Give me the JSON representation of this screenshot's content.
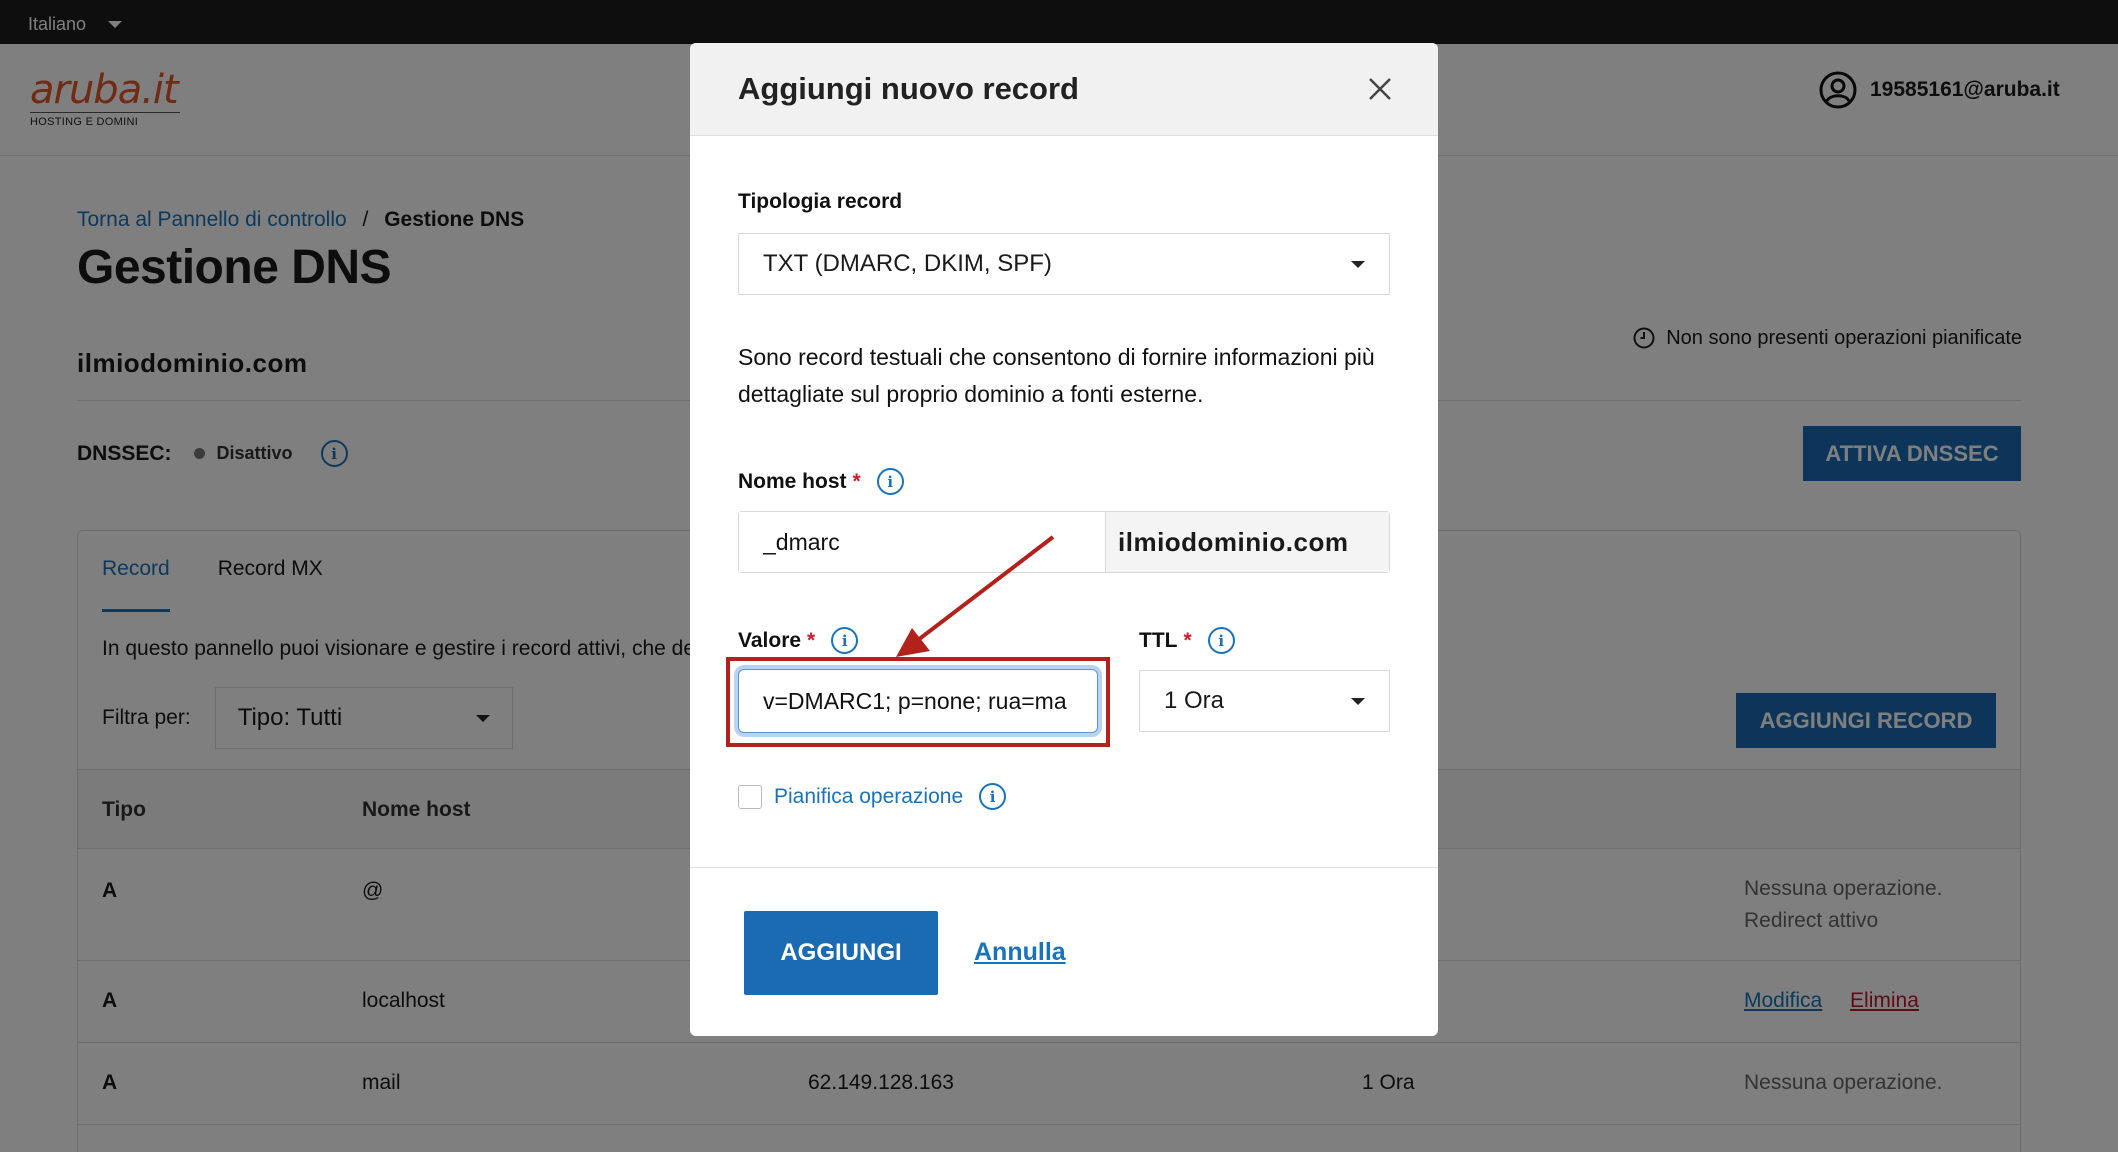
{
  "topbar": {
    "language": "Italiano"
  },
  "header": {
    "logo_text": "aruba.it",
    "logo_sub": "HOSTING E DOMINI",
    "user_email": "19585161@aruba.it"
  },
  "breadcrumb": {
    "back_link": "Torna al Pannello di controllo",
    "separator": "/",
    "current": "Gestione DNS"
  },
  "page": {
    "title": "Gestione DNS",
    "domain": "ilmiodominio.com",
    "scheduled_ops": "Non sono presenti operazioni pianificate",
    "dnssec_label": "DNSSEC:",
    "dnssec_state": "Disattivo",
    "dnssec_button": "ATTIVA DNSSEC"
  },
  "panel": {
    "tabs": [
      {
        "label": "Record"
      },
      {
        "label": "Record MX"
      }
    ],
    "description": "In questo pannello puoi visionare e gestire i record attivi, che de",
    "filter_label": "Filtra per:",
    "filter_value": "Tipo: Tutti",
    "add_button": "AGGIUNGI RECORD",
    "columns": [
      "Tipo",
      "Nome host"
    ],
    "rows": [
      {
        "type": "A",
        "host": "@",
        "value": "",
        "ttl": "",
        "status_line1": "Nessuna operazione.",
        "status_line2": "Redirect attivo"
      },
      {
        "type": "A",
        "host": "localhost",
        "value": "",
        "ttl": "",
        "action_edit": "Modifica",
        "action_delete": "Elimina"
      },
      {
        "type": "A",
        "host": "mail",
        "value": "62.149.128.163",
        "ttl": "1 Ora",
        "status_line1": "Nessuna operazione."
      }
    ]
  },
  "modal": {
    "title": "Aggiungi nuovo record",
    "record_type_label": "Tipologia record",
    "record_type_value": "TXT (DMARC, DKIM, SPF)",
    "description": "Sono record testuali che consentono di fornire informazioni più dettagliate sul proprio dominio a fonti esterne.",
    "host_label": "Nome host",
    "required_mark": "*",
    "host_value": "_dmarc",
    "host_suffix": "ilmiodominio.com",
    "value_label": "Valore",
    "value_value": "v=DMARC1; p=none; rua=ma",
    "ttl_label": "TTL",
    "ttl_value": "1 Ora",
    "schedule_label": "Pianifica operazione",
    "submit_button": "AGGIUNGI",
    "cancel_link": "Annulla"
  },
  "colors": {
    "brand_orange": "#e0562a",
    "primary_blue": "#1b6bb2",
    "link_blue": "#1a72b8",
    "highlight_red": "#b3211b",
    "required_red": "#d11a2a"
  },
  "icons": [
    "chevron-down-icon",
    "user-circle-icon",
    "clock-icon",
    "info-icon",
    "close-icon",
    "arrow-annotation"
  ]
}
